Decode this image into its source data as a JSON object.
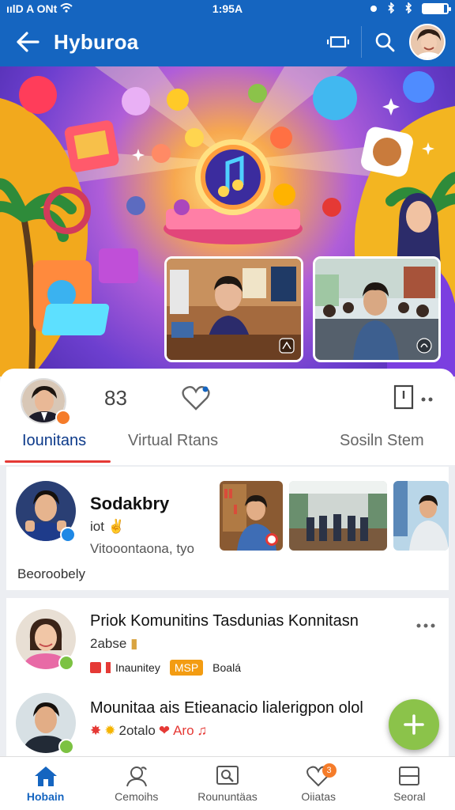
{
  "status_bar": {
    "left_text": "ıılD A ONt",
    "time": "1:95A",
    "battery_level": 0.85
  },
  "app_bar": {
    "title": "Hyburoa"
  },
  "profile": {
    "count": "83"
  },
  "tabs": [
    {
      "label": "Iounitans",
      "active": true
    },
    {
      "label": "Virtual Rtans",
      "active": false
    },
    {
      "label": "Sosiln Stem",
      "active": false
    }
  ],
  "post1": {
    "name": "Sodakbry",
    "line1": "iot",
    "line2": "Vitooontaona, tyo",
    "footer": "Beoroobely"
  },
  "post2": {
    "title": "Priok Komunitins Tasdunias Konnitasn",
    "meta": "2abse",
    "tag1": "Inaunitey",
    "tag2": "MSP",
    "tag3": "Boalá"
  },
  "post3": {
    "title": "Mounitaa ais Etieanacio lialerigpon olol",
    "meta": "2otalo",
    "meta2": "Aro"
  },
  "nav": [
    {
      "label": "Hobain",
      "icon": "home-icon",
      "active": true
    },
    {
      "label": "Cemoihs",
      "icon": "person-chat-icon",
      "active": false
    },
    {
      "label": "Roununtäas",
      "icon": "gallery-search-icon",
      "active": false
    },
    {
      "label": "Oiiatas",
      "icon": "heart-icon",
      "active": false,
      "badge": "3"
    },
    {
      "label": "Seoral",
      "icon": "menu-icon",
      "active": false
    }
  ],
  "colors": {
    "primary": "#1565c0",
    "accent": "#e53935",
    "fab": "#8bc34a"
  }
}
